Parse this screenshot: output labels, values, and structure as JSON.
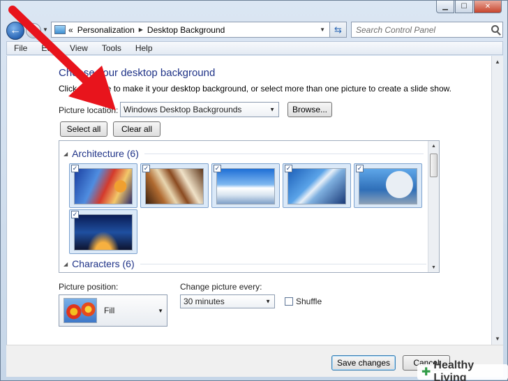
{
  "navigation": {
    "breadcrumb": [
      "«",
      "Personalization",
      "Desktop Background"
    ],
    "search_placeholder": "Search Control Panel"
  },
  "menu": [
    "File",
    "Edit",
    "View",
    "Tools",
    "Help"
  ],
  "main": {
    "heading": "Choose your desktop background",
    "description": "Click a picture to make it your desktop background, or select more than one picture to create a slide show.",
    "picture_location_label": "Picture location:",
    "picture_location_value": "Windows Desktop Backgrounds",
    "browse_label": "Browse...",
    "select_all_label": "Select all",
    "clear_all_label": "Clear all",
    "groups": [
      {
        "title": "Architecture (6)",
        "images": [
          {
            "checked": true,
            "subject": "tower"
          },
          {
            "checked": true,
            "subject": "metal-curves"
          },
          {
            "checked": true,
            "subject": "white-building"
          },
          {
            "checked": true,
            "subject": "blue-structure"
          },
          {
            "checked": true,
            "subject": "dotted-facade"
          },
          {
            "checked": true,
            "subject": "night-arches"
          }
        ]
      },
      {
        "title": "Characters (6)",
        "images": []
      }
    ],
    "picture_position_label": "Picture position:",
    "picture_position_value": "Fill",
    "change_every_label": "Change picture every:",
    "change_every_value": "30 minutes",
    "shuffle_label": "Shuffle",
    "shuffle_checked": false
  },
  "footer": {
    "save_label": "Save changes",
    "cancel_label": "Cancel"
  },
  "watermark": {
    "text": "Healthy Living"
  },
  "colors": {
    "heading": "#1e3287",
    "annotation_arrow": "#e8141c",
    "watermark_cross": "#2f9b46"
  }
}
